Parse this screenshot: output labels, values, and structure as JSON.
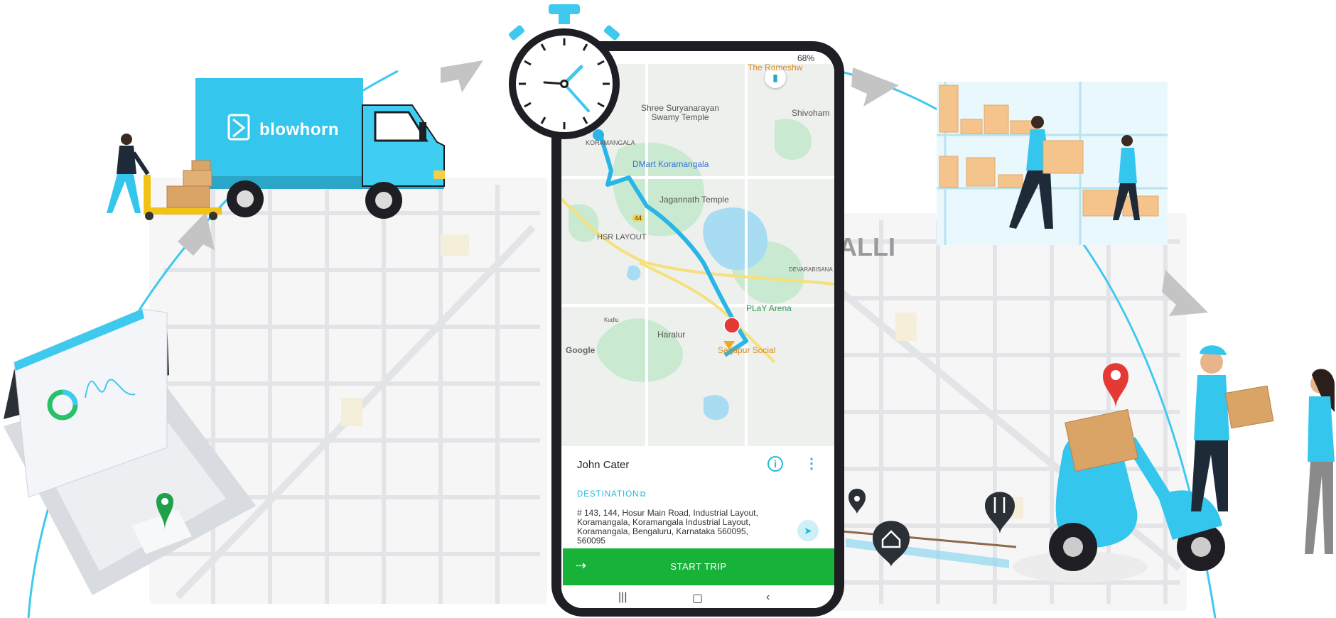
{
  "truck": {
    "brand": "blowhorn"
  },
  "background_map": {
    "area_label": "ALLI"
  },
  "phone": {
    "status_bar": {
      "battery": "68%"
    },
    "map": {
      "labels": {
        "rameshwaram": "The Rameshw",
        "suryanarayan": "Shree Suryanarayan\nSwamy Temple",
        "shivoham": "Shivoham",
        "koramangala": "KORAMANGALA",
        "dmart": "DMart Koramangala",
        "jagannath": "Jagannath Temple",
        "hsr": "HSR LAYOUT",
        "route_no": "44",
        "devarabisana": "DEVARABISANA",
        "play_arena": "PLaY Arena",
        "haralur": "Haralur",
        "kudlu": "Kudlu",
        "sarjapur": "Sarjapur Social",
        "google": "Google"
      }
    },
    "trip": {
      "customer_name": "John Cater",
      "destination_label": "DESTINATION",
      "address": "# 143, 144, Hosur Main Road, Industrial Layout, Koramangala, Koramangala Industrial Layout, Koramangala, Bengaluru, Karnataka 560095, 560095",
      "start_label": "START TRIP"
    }
  },
  "colors": {
    "accent": "#3ec9ef",
    "button_green": "#17b338",
    "route_blue": "#4fc3e8",
    "pin_red": "#e53935",
    "pin_green": "#1fa14a"
  },
  "icons": [
    "stopwatch-icon",
    "info-icon",
    "more-vert-icon",
    "copy-icon",
    "navigate-icon",
    "arrow-right-icon",
    "map-pin-icon",
    "home-pin-icon",
    "restaurant-pin-icon"
  ]
}
